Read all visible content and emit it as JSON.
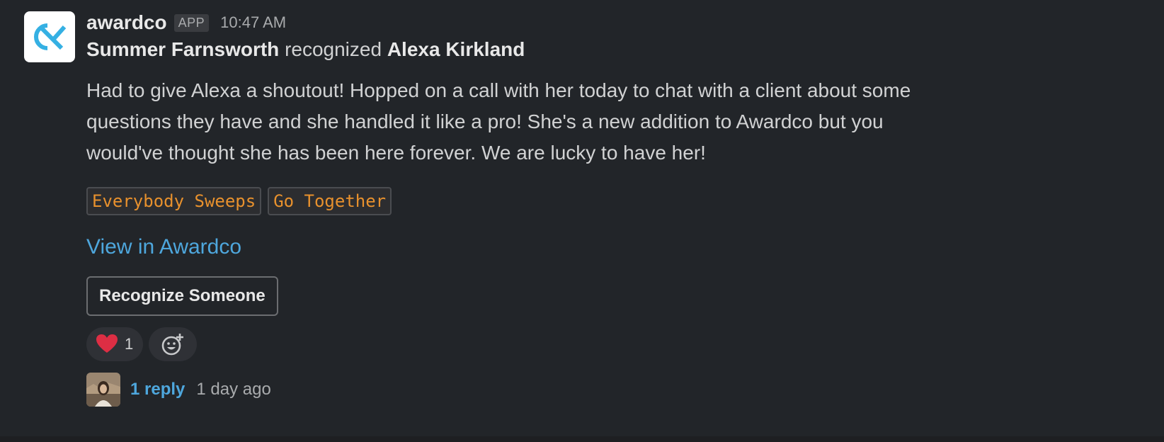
{
  "message": {
    "sender": "awardco",
    "badge": "APP",
    "time": "10:47 AM",
    "recognizer": "Summer Farnsworth",
    "action": "recognized",
    "recipient": "Alexa Kirkland",
    "body": "Had to give Alexa a shoutout! Hopped on a call with her today to chat with a client about some questions they have and she handled it like a pro! She's a new addition to Awardco but you would've thought she has been here forever. We are lucky to have her!",
    "tags": [
      "Everybody Sweeps",
      "Go Together"
    ],
    "link_label": "View in Awardco",
    "button_label": "Recognize Someone",
    "reactions": [
      {
        "icon": "heart-icon",
        "count": "1"
      }
    ],
    "thread": {
      "replies": "1 reply",
      "when": "1 day ago"
    }
  },
  "colors": {
    "background": "#222529",
    "link": "#4ea7dd",
    "tag_text": "#e8912d",
    "brand": "#1d9bd1"
  }
}
